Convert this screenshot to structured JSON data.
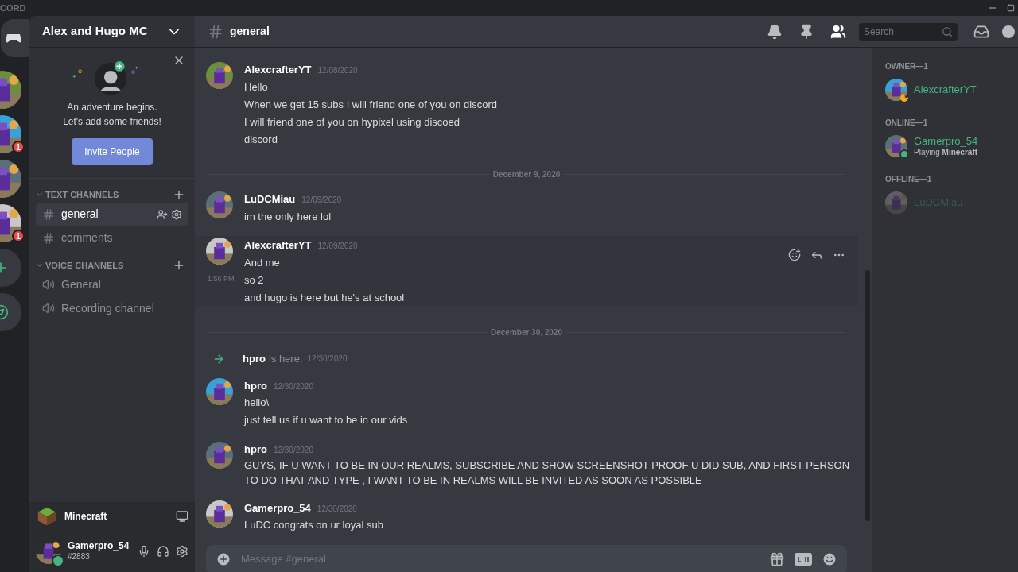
{
  "titlebar": {
    "app_name": "CORD"
  },
  "servers": [
    {
      "kind": "picture"
    },
    {
      "kind": "picture",
      "badge": "1"
    },
    {
      "kind": "picture"
    },
    {
      "kind": "picture",
      "badge": "1"
    }
  ],
  "server_name": "Alex and Hugo MC",
  "invite_card": {
    "line1": "An adventure begins.",
    "line2": "Let's add some friends!",
    "button": "Invite People"
  },
  "categories": [
    {
      "name": "TEXT CHANNELS",
      "expanded": true,
      "channels": [
        {
          "kind": "text",
          "name": "general",
          "selected": true
        },
        {
          "kind": "text",
          "name": "comments",
          "selected": false
        }
      ]
    },
    {
      "name": "VOICE CHANNELS",
      "expanded": true,
      "channels": [
        {
          "kind": "voice",
          "name": "General",
          "selected": false
        },
        {
          "kind": "voice",
          "name": "Recording channel",
          "selected": false
        }
      ]
    }
  ],
  "activity": {
    "game": "Minecraft"
  },
  "user": {
    "name": "Gamerpro_54",
    "tag": "#2883",
    "color": "#43b581"
  },
  "channel_header": {
    "name": "general",
    "search_placeholder": "Search"
  },
  "messages": [
    {
      "kind": "message",
      "author": "AlexcrafterYT",
      "time": "12/08/2020",
      "hovered": false,
      "lines": [
        {
          "text": "Hello"
        },
        {
          "text": "When we get 15 subs I will friend one of you on discord"
        },
        {
          "text": "I will friend one of you on hypixel using discoed"
        },
        {
          "text": "discord"
        }
      ]
    },
    {
      "kind": "divider",
      "label": "December 9, 2020"
    },
    {
      "kind": "message",
      "author": "LuDCMiau",
      "time": "12/09/2020",
      "hovered": false,
      "lines": [
        {
          "text": "im the only here lol"
        }
      ]
    },
    {
      "kind": "message",
      "author": "AlexcrafterYT",
      "time": "12/09/2020",
      "hovered": true,
      "lines": [
        {
          "text": "And me"
        },
        {
          "text": "so 2",
          "time": "1:56 PM"
        },
        {
          "text": "and hugo is here but he's at school"
        }
      ]
    },
    {
      "kind": "divider",
      "label": "December 30, 2020"
    },
    {
      "kind": "join",
      "author": "hpro",
      "text": "is here.",
      "time": "12/30/2020"
    },
    {
      "kind": "message",
      "author": "hpro",
      "time": "12/30/2020",
      "hovered": false,
      "lines": [
        {
          "text": "hello\\"
        },
        {
          "text": "just tell us if u want to be in our vids"
        }
      ]
    },
    {
      "kind": "message",
      "author": "hpro",
      "time": "12/30/2020",
      "hovered": false,
      "lines": [
        {
          "text": "GUYS, IF U WANT TO BE IN OUR REALMS, SUBSCRIBE AND  SHOW SCREENSHOT  PROOF U DID SUB, AND FIRST PERSON TO DO THAT AND TYPE , I WANT TO BE IN REALMS WILL BE INVITED AS SOON AS POSSIBLE"
        }
      ]
    },
    {
      "kind": "message",
      "author": "Gamerpro_54",
      "time": "12/30/2020",
      "hovered": false,
      "lines": [
        {
          "text": "LuDC congrats on ur loyal sub"
        }
      ]
    }
  ],
  "composer": {
    "placeholder": "Message #general"
  },
  "member_groups": [
    {
      "label": "OWNER—1",
      "members": [
        {
          "name": "AlexcrafterYT",
          "kind": "idle"
        }
      ]
    },
    {
      "label": "ONLINE—1",
      "members": [
        {
          "name": "Gamerpro_54",
          "kind": "online",
          "activity": "Playing",
          "game": "Minecraft"
        }
      ]
    },
    {
      "label": "OFFLINE—1",
      "members": [
        {
          "name": "LuDCMiau",
          "kind": "offline"
        }
      ]
    }
  ]
}
